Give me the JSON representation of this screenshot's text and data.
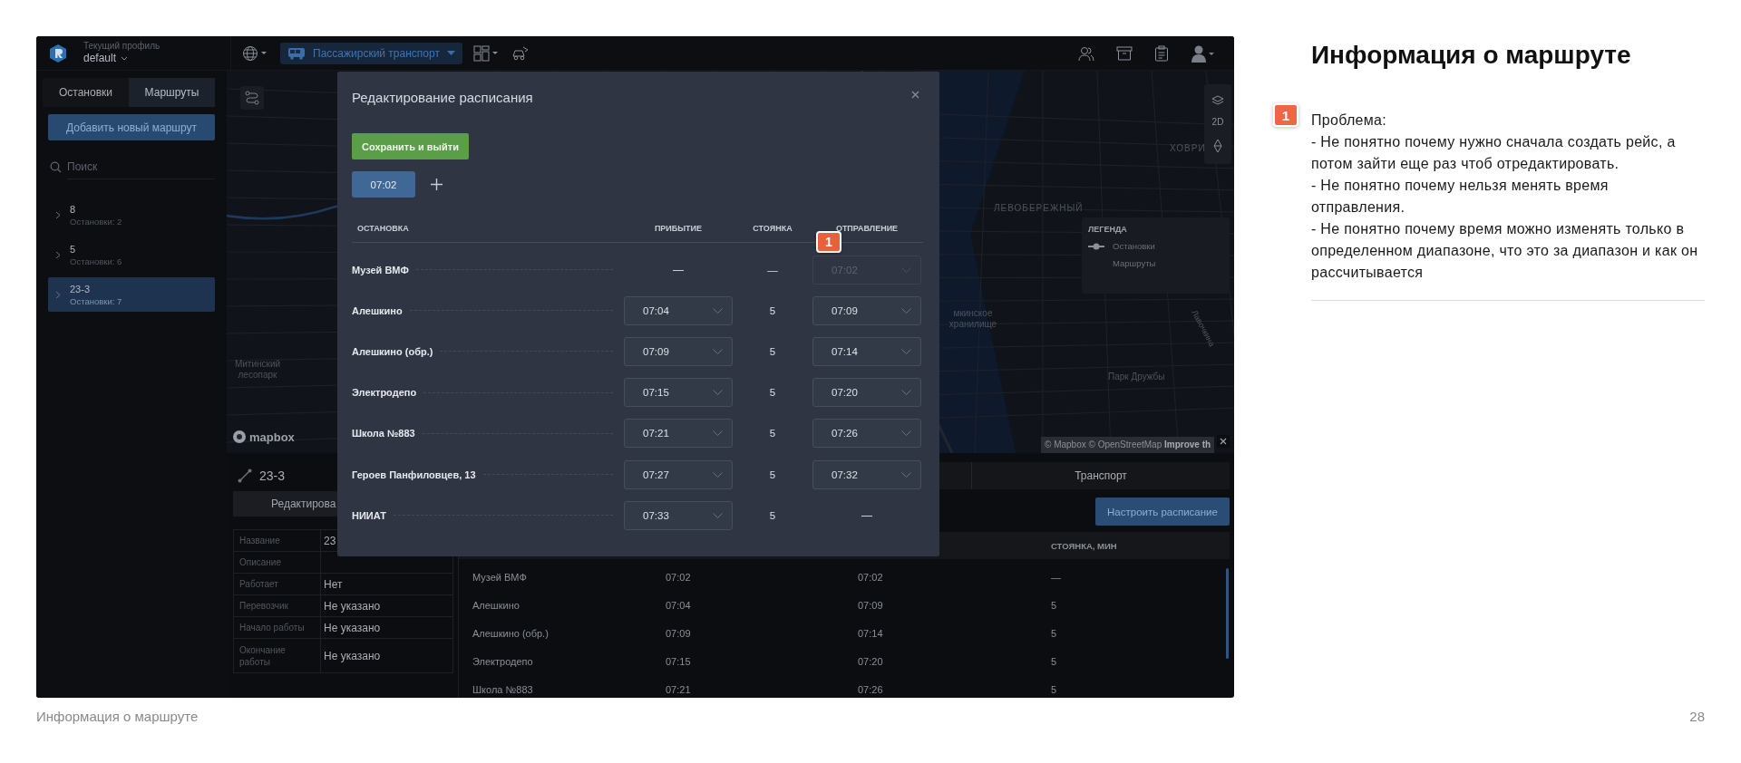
{
  "app": {
    "header": {
      "profile_label": "Текущий профиль",
      "profile_name": "default",
      "transport_mode": "Пассажирский транспорт"
    },
    "sidebar": {
      "tabs": [
        {
          "label": "Остановки",
          "selected": false
        },
        {
          "label": "Маршруты",
          "selected": true
        }
      ],
      "add_button": "Добавить новый маршрут",
      "search": {
        "placeholder": "Поиск"
      },
      "routes": [
        {
          "name": "8",
          "stops": "Остановки: 2",
          "selected": false
        },
        {
          "name": "5",
          "stops": "Остановки: 6",
          "selected": false
        },
        {
          "name": "23-3",
          "stops": "Остановки: 7",
          "selected": true
        }
      ]
    },
    "map": {
      "labels": [
        "ХОВРИ",
        "ЛЕВОБЕРЕЖНЫЙ",
        "мкинское хранилище",
        "Лавочкина",
        "Митинский лесопарк",
        "Парк Дружбы"
      ],
      "logo": "mapbox",
      "view_mode": "2D",
      "legend": {
        "title": "ЛЕГЕНДА",
        "items": [
          {
            "label": "Остановки",
            "kind": "stop"
          },
          {
            "label": "Маршруты",
            "kind": "route"
          }
        ]
      },
      "attribution": "© Mapbox © OpenStreetMap",
      "attribution_link": "Improve th"
    },
    "route_panel": {
      "title": "23-3",
      "edit_button": "Редактирова",
      "properties": [
        {
          "label": "Название",
          "value": "23"
        },
        {
          "label": "Описание"
        },
        {
          "label": "Работает",
          "value": "Нет"
        },
        {
          "label": "Перевозчик",
          "value": "Не указано"
        },
        {
          "label": "Начало работы",
          "value": "Не указано"
        },
        {
          "label": "Окончание работы",
          "value": "Не указано"
        }
      ]
    },
    "schedule_panel": {
      "tab": "Транспорт",
      "configure_button": "Настроить расписание",
      "stay_column": "СТОЯНКА, МИН",
      "rows": [
        {
          "stop": "Музей ВМФ",
          "arrival": "07:02",
          "departure": "07:02",
          "stay": "—"
        },
        {
          "stop": "Алешкино",
          "arrival": "07:04",
          "departure": "07:09",
          "stay": "5"
        },
        {
          "stop": "Алешкино (обр.)",
          "arrival": "07:09",
          "departure": "07:14",
          "stay": "5"
        },
        {
          "stop": "Электродепо",
          "arrival": "07:15",
          "departure": "07:20",
          "stay": "5"
        },
        {
          "stop": "Школа №883",
          "arrival": "07:21",
          "departure": "07:26",
          "stay": "5"
        }
      ]
    },
    "modal": {
      "title": "Редактирование расписания",
      "save_button": "Сохранить и выйти",
      "trips": [
        {
          "time": "07:02",
          "selected": true
        }
      ],
      "columns": [
        "ОСТАНОВКА",
        "ПРИБЫТИЕ",
        "СТОЯНКА",
        "ОТПРАВЛЕНИЕ"
      ],
      "annotation_marker": "1",
      "rows": [
        {
          "stop": "Музей ВМФ",
          "arrival": {
            "value": "—",
            "kind": "dash"
          },
          "stay": "—",
          "departure": {
            "value": "07:02",
            "kind": "disabled_select"
          }
        },
        {
          "stop": "Алешкино",
          "arrival": {
            "value": "07:04",
            "kind": "select"
          },
          "stay": "5",
          "departure": {
            "value": "07:09",
            "kind": "select"
          }
        },
        {
          "stop": "Алешкино (обр.)",
          "arrival": {
            "value": "07:09",
            "kind": "select"
          },
          "stay": "5",
          "departure": {
            "value": "07:14",
            "kind": "select"
          }
        },
        {
          "stop": "Электродепо",
          "arrival": {
            "value": "07:15",
            "kind": "select"
          },
          "stay": "5",
          "departure": {
            "value": "07:20",
            "kind": "select"
          }
        },
        {
          "stop": "Школа №883",
          "arrival": {
            "value": "07:21",
            "kind": "select"
          },
          "stay": "5",
          "departure": {
            "value": "07:26",
            "kind": "select"
          }
        },
        {
          "stop": "Героев Панфиловцев, 13",
          "arrival": {
            "value": "07:27",
            "kind": "select"
          },
          "stay": "5",
          "departure": {
            "value": "07:32",
            "kind": "select"
          }
        },
        {
          "stop": "НИИАТ",
          "arrival": {
            "value": "07:33",
            "kind": "select"
          },
          "stay": "5",
          "departure": {
            "value": "—",
            "kind": "dash"
          }
        }
      ]
    }
  },
  "slide": {
    "title": "Информация о маршруте",
    "note": {
      "marker": "1",
      "heading": "Проблема:",
      "items": [
        "- Не понятно почему нужно сначала создать рейс, а потом зайти еще раз чтоб отредактировать.",
        "- Не понятно почему нельзя менять время отправления.",
        "- Не понятно почему время можно изменять только в определенном диапазоне, что это за диапазон и как он рассчитывается"
      ]
    },
    "footer_title": "Информация о маршруте",
    "page_number": "28"
  }
}
